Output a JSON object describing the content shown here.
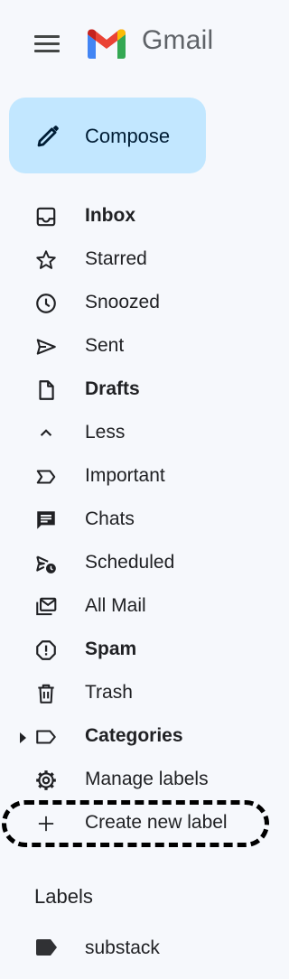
{
  "header": {
    "app_name": "Gmail",
    "menu_icon": "hamburger-menu-icon",
    "logo_icon": "gmail-logo-icon"
  },
  "compose": {
    "label": "Compose",
    "icon": "pencil-icon",
    "color": "#c2e7ff"
  },
  "nav": {
    "items": [
      {
        "label": "Inbox",
        "icon": "inbox-icon",
        "bold": true
      },
      {
        "label": "Starred",
        "icon": "star-icon",
        "bold": false
      },
      {
        "label": "Snoozed",
        "icon": "clock-icon",
        "bold": false
      },
      {
        "label": "Sent",
        "icon": "send-icon",
        "bold": false
      },
      {
        "label": "Drafts",
        "icon": "draft-icon",
        "bold": true
      },
      {
        "label": "Less",
        "icon": "chevron-up-icon",
        "bold": false
      },
      {
        "label": "Important",
        "icon": "important-icon",
        "bold": false
      },
      {
        "label": "Chats",
        "icon": "chat-icon",
        "bold": false
      },
      {
        "label": "Scheduled",
        "icon": "scheduled-send-icon",
        "bold": false
      },
      {
        "label": "All Mail",
        "icon": "all-mail-icon",
        "bold": false
      },
      {
        "label": "Spam",
        "icon": "spam-icon",
        "bold": true
      },
      {
        "label": "Trash",
        "icon": "trash-icon",
        "bold": false
      },
      {
        "label": "Categories",
        "icon": "label-icon",
        "bold": true
      },
      {
        "label": "Manage labels",
        "icon": "gear-icon",
        "bold": false
      },
      {
        "label": "Create new label",
        "icon": "plus-icon",
        "bold": false
      }
    ]
  },
  "labels": {
    "title": "Labels",
    "items": [
      {
        "label": "substack",
        "icon": "label-filled-icon"
      }
    ]
  }
}
